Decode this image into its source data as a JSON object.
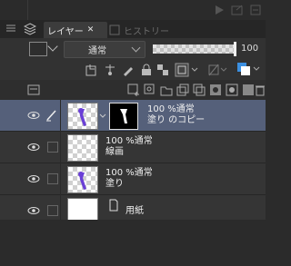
{
  "panel": {
    "tabs": [
      {
        "label": "レイヤー",
        "active": true
      },
      {
        "label": "ヒストリー",
        "active": false
      }
    ]
  },
  "toolbar": {
    "blend_mode": "通常",
    "opacity_value": "100",
    "opacity_fraction": 1.0
  },
  "layers": [
    {
      "opacity_mode": "100 %通常",
      "name": "塗り のコピー",
      "selected": true,
      "has_mask": true,
      "thumbnail": "checker-purple"
    },
    {
      "opacity_mode": "100 %通常",
      "name": "線画",
      "selected": false,
      "has_mask": false,
      "thumbnail": "checker-empty"
    },
    {
      "opacity_mode": "100 %通常",
      "name": "塗り",
      "selected": false,
      "has_mask": false,
      "thumbnail": "checker-purple"
    },
    {
      "opacity_mode": "",
      "name": "用紙",
      "selected": false,
      "has_mask": false,
      "thumbnail": "white"
    }
  ],
  "colors": {
    "selected_row": "#55607a",
    "accent_blue": "#3b8fe0",
    "purple_stroke": "#6a3fd6"
  }
}
